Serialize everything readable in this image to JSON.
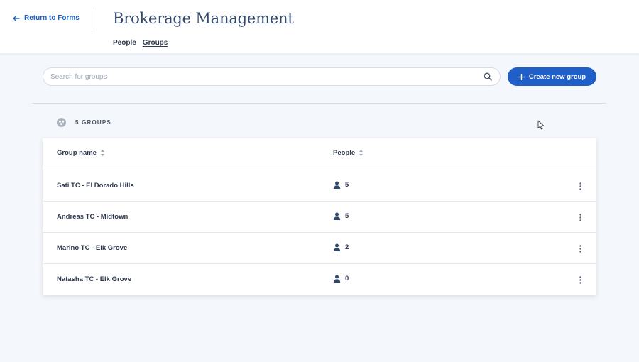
{
  "header": {
    "back_label": "Return to Forms",
    "title": "Brokerage Management",
    "tabs": [
      {
        "label": "People",
        "active": false
      },
      {
        "label": "Groups",
        "active": true
      }
    ]
  },
  "search": {
    "placeholder": "Search for groups",
    "value": ""
  },
  "toolbar": {
    "create_label": "Create new group"
  },
  "summary": {
    "count_label": "5 GROUPS"
  },
  "table": {
    "columns": [
      "Group name",
      "People"
    ],
    "rows": [
      {
        "name": "Sati TC - El Dorado Hills",
        "people": "5"
      },
      {
        "name": "Andreas TC - Midtown",
        "people": "5"
      },
      {
        "name": "Marino TC - Elk Grove",
        "people": "2"
      },
      {
        "name": "Natasha TC - Elk Grove",
        "people": "0"
      }
    ]
  },
  "colors": {
    "accent": "#1f5fc7",
    "title": "#33496b",
    "background": "#f4f7fb"
  },
  "icons": {
    "back": "arrow-left-icon",
    "search": "search-icon",
    "create": "plus-icon",
    "groups": "groups-icon",
    "sort": "sort-icon",
    "person": "person-icon",
    "more": "kebab-menu-icon"
  }
}
